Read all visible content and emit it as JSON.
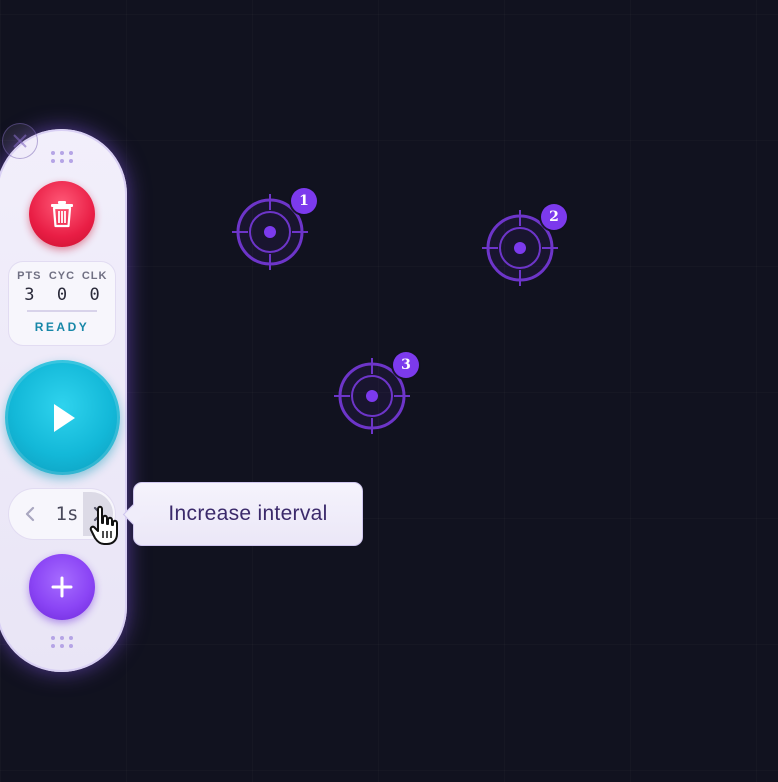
{
  "targets": [
    {
      "label": "1"
    },
    {
      "label": "2"
    },
    {
      "label": "3"
    }
  ],
  "panel": {
    "close_icon": "close-icon",
    "trash_icon": "trash-icon",
    "stats": {
      "labels": [
        "PTS",
        "CYC",
        "CLK"
      ],
      "values": [
        "3",
        "0",
        "0"
      ],
      "status": "READY"
    },
    "play_icon": "play-icon",
    "interval": {
      "value": "1s",
      "decrease_icon": "chevron-left-icon",
      "increase_icon": "chevron-right-icon"
    },
    "add_icon": "plus-icon"
  },
  "tooltip": {
    "text": "Increase interval"
  },
  "colors": {
    "background": "#11121f",
    "accent": "#7c3aed",
    "danger": "#e91e45",
    "play": "#13b8d8",
    "status": "#1787a8"
  }
}
